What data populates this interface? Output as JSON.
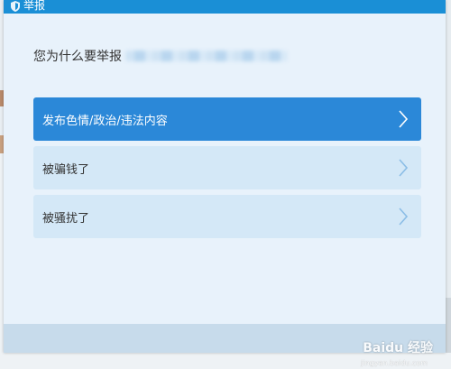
{
  "dialog": {
    "title": "举报",
    "question": "您为什么要举报"
  },
  "options": [
    {
      "label": "发布色情/政治/违法内容",
      "selected": true
    },
    {
      "label": "被骗钱了",
      "selected": false
    },
    {
      "label": "被骚扰了",
      "selected": false
    }
  ],
  "watermark": {
    "text": "Baidu 经验",
    "sub": "jingyan.baidu.com"
  },
  "colors": {
    "titlebar": "#1a8fd6",
    "selected_option": "#2b88d8",
    "option": "#d4e8f7",
    "dialog_bg": "#e8f2fb"
  }
}
